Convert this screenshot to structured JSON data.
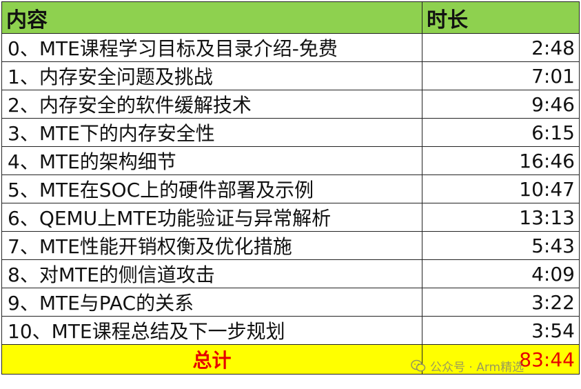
{
  "table": {
    "headers": [
      "内容",
      "时长"
    ],
    "rows": [
      {
        "content": "0、MTE课程学习目标及目录介绍-免费",
        "duration": "2:48"
      },
      {
        "content": "1、内存安全问题及挑战",
        "duration": "7:01"
      },
      {
        "content": "2、内存安全的软件缓解技术",
        "duration": "9:46"
      },
      {
        "content": "3、MTE下的内存安全性",
        "duration": "6:15"
      },
      {
        "content": "4、MTE的架构细节",
        "duration": "16:46"
      },
      {
        "content": "5、MTE在SOC上的硬件部署及示例",
        "duration": "10:47"
      },
      {
        "content": "6、QEMU上MTE功能验证与异常解析",
        "duration": "13:13"
      },
      {
        "content": "7、MTE性能开销权衡及优化措施",
        "duration": "5:43"
      },
      {
        "content": "8、对MTE的侧信道攻击",
        "duration": "4:09"
      },
      {
        "content": "9、MTE与PAC的关系",
        "duration": "3:22"
      },
      {
        "content": "10、MTE课程总结及下一步规划",
        "duration": "3:54"
      }
    ],
    "total": {
      "label": "总计",
      "duration": "83:44"
    }
  },
  "watermark": {
    "text": "公众号 · Arm精选",
    "icon": "wechat-icon"
  },
  "colors": {
    "header_bg": "#8ed14f",
    "total_bg": "#ffff00",
    "total_text": "#e60000"
  }
}
